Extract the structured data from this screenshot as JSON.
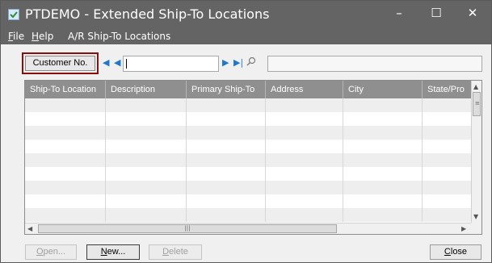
{
  "window": {
    "title": "PTDEMO - Extended Ship-To Locations",
    "controls": {
      "minimize": "–",
      "maximize": "☐",
      "close": "✕"
    }
  },
  "menu": {
    "file": {
      "accel": "F",
      "rest": "ile"
    },
    "help": {
      "accel": "H",
      "rest": "elp"
    },
    "ar": "A/R Ship-To Locations"
  },
  "toolbar": {
    "customer_button": "Customer No.",
    "customer_value": "",
    "customer_description": ""
  },
  "grid": {
    "columns": [
      "Ship-To Location",
      "Description",
      "Primary Ship-To",
      "Address",
      "City",
      "State/Pro"
    ],
    "rows": 9
  },
  "footer": {
    "open": {
      "accel": "O",
      "rest": "pen...",
      "enabled": false
    },
    "new": {
      "accel": "N",
      "rest": "ew...",
      "enabled": true
    },
    "delete": {
      "accel": "D",
      "rest": "elete",
      "enabled": false
    },
    "close": {
      "accel": "C",
      "rest": "lose",
      "enabled": true
    }
  },
  "icons": {
    "app": "checkmark-app-icon",
    "first": "first-record-icon",
    "previous": "previous-record-icon",
    "next": "next-record-icon",
    "last": "last-record-icon",
    "finder": "search-icon"
  },
  "colors": {
    "titlebar": "#646464",
    "highlight_frame": "#8b0e0e",
    "nav_arrows": "#1f78c8",
    "grid_header": "#8f8f8f",
    "alt_row": "#eeeeee"
  }
}
